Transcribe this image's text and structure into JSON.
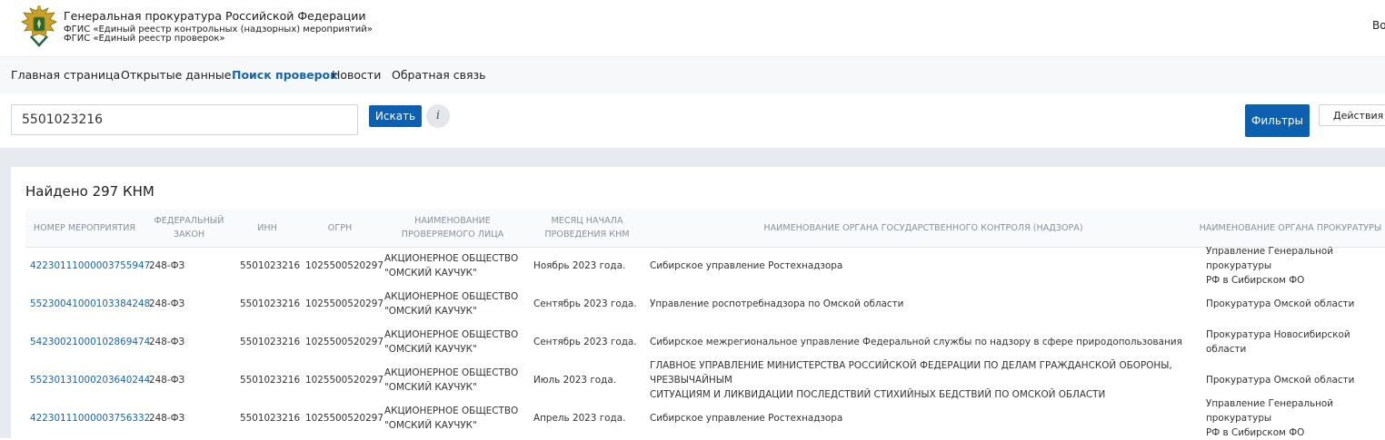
{
  "header": {
    "org_title": "Генеральная прокуратура Российской Федерации",
    "subtitle_1": "ФГИС «Единый реестр контрольных (надзорных) мероприятий»",
    "subtitle_2": "ФГИС «Единый реестр проверок»",
    "login_partial": "Во",
    "emblem_icon": "eagle-emblem-icon"
  },
  "nav": {
    "items": [
      {
        "label": "Главная страница"
      },
      {
        "label": "Открытые данные"
      },
      {
        "label": "Поиск проверок",
        "active": true
      },
      {
        "label": "Новости"
      },
      {
        "label": "Обратная связь"
      }
    ]
  },
  "search": {
    "value": "5501023216",
    "button_label": "Искать",
    "info_label": "i",
    "filters_label": "Фильтры",
    "actions_label": "Действия"
  },
  "results": {
    "found_label": "Найдено 297 КНМ",
    "columns": [
      [
        "НОМЕР МЕРОПРИЯТИЯ"
      ],
      [
        "ФЕДЕРАЛЬНЫЙ",
        "ЗАКОН"
      ],
      [
        "ИНН"
      ],
      [
        "ОГРН"
      ],
      [
        "НАИМЕНОВАНИЕ",
        "ПРОВЕРЯЕМОГО ЛИЦА"
      ],
      [
        "МЕСЯЦ НАЧАЛА",
        "ПРОВЕДЕНИЯ КНМ"
      ],
      [
        "НАИМЕНОВАНИЕ ОРГАНА ГОСУДАРСТВЕННОГО КОНТРОЛЯ (НАДЗОРА)"
      ],
      [
        "НАИМЕНОВАНИЕ ОРГАНА ПРОКУРАТУРЫ"
      ]
    ],
    "rows": [
      {
        "number": "42230111000003755947",
        "law": "248-ФЗ",
        "inn": "5501023216",
        "ogrn": "1025500520297",
        "name": [
          "АКЦИОНЕРНОЕ ОБЩЕСТВО",
          "\"ОМСКИЙ КАУЧУК\""
        ],
        "month": "Ноябрь 2023 года.",
        "control_body": [
          "Сибирское управление Ростехнадзора"
        ],
        "prosecutor": [
          "Управление Генеральной прокуратуры",
          "РФ в Сибирском ФО"
        ]
      },
      {
        "number": "55230041000103384248",
        "law": "248-ФЗ",
        "inn": "5501023216",
        "ogrn": "1025500520297",
        "name": [
          "АКЦИОНЕРНОЕ ОБЩЕСТВО",
          "\"ОМСКИЙ КАУЧУК\""
        ],
        "month": "Сентябрь 2023 года.",
        "control_body": [
          "Управление роспотребнадзора по Омской области"
        ],
        "prosecutor": [
          "Прокуратура Омской области"
        ]
      },
      {
        "number": "54230021000102869474",
        "law": "248-ФЗ",
        "inn": "5501023216",
        "ogrn": "1025500520297",
        "name": [
          "АКЦИОНЕРНОЕ ОБЩЕСТВО",
          "\"ОМСКИЙ КАУЧУК\""
        ],
        "month": "Сентябрь 2023 года.",
        "control_body": [
          "Сибирское межрегиональное управление Федеральной службы по надзору в сфере природопользования"
        ],
        "prosecutor": [
          "Прокуратура Новосибирской области"
        ]
      },
      {
        "number": "55230131000203640244",
        "law": "248-ФЗ",
        "inn": "5501023216",
        "ogrn": "1025500520297",
        "name": [
          "АКЦИОНЕРНОЕ ОБЩЕСТВО",
          "\"ОМСКИЙ КАУЧУК\""
        ],
        "month": "Июль 2023 года.",
        "control_body": [
          "ГЛАВНОЕ УПРАВЛЕНИЕ МИНИСТЕРСТВА РОССИЙСКОЙ ФЕДЕРАЦИИ ПО ДЕЛАМ ГРАЖДАНСКОЙ ОБОРОНЫ, ЧРЕЗВЫЧАЙНЫМ",
          "СИТУАЦИЯМ И ЛИКВИДАЦИИ ПОСЛЕДСТВИЙ СТИХИЙНЫХ БЕДСТВИЙ ПО ОМСКОЙ ОБЛАСТИ"
        ],
        "prosecutor": [
          "Прокуратура Омской области"
        ]
      },
      {
        "number": "42230111000003756332",
        "law": "248-ФЗ",
        "inn": "5501023216",
        "ogrn": "1025500520297",
        "name": [
          "АКЦИОНЕРНОЕ ОБЩЕСТВО",
          "\"ОМСКИЙ КАУЧУК\""
        ],
        "month": "Апрель 2023 года.",
        "control_body": [
          "Сибирское управление Ростехнадзора"
        ],
        "prosecutor": [
          "Управление Генеральной прокуратуры",
          "РФ в Сибирском ФО"
        ]
      }
    ]
  },
  "colors": {
    "primary": "#0d5fb0",
    "link": "#1565b0",
    "header_text_gray": "#8a9099",
    "page_gray": "#e7eaee"
  }
}
